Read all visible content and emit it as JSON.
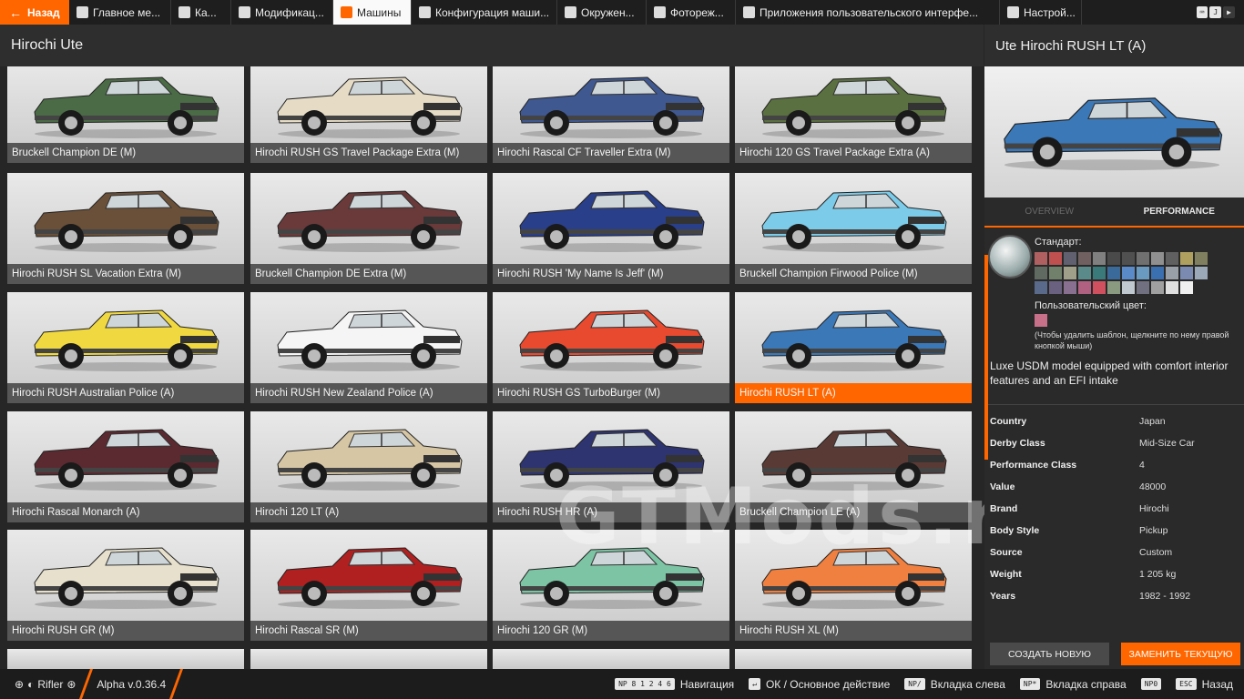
{
  "topbar": {
    "back_label": "Назад",
    "tabs": [
      {
        "label": "Главное ме...",
        "icon": "home-icon"
      },
      {
        "label": "Ка...",
        "icon": "map-icon"
      },
      {
        "label": "Модификац...",
        "icon": "puzzle-icon"
      },
      {
        "label": "Машины",
        "icon": "car-icon",
        "active": true
      },
      {
        "label": "Конфигурация маши...",
        "icon": "car-config-icon"
      },
      {
        "label": "Окружен...",
        "icon": "environment-icon"
      },
      {
        "label": "Фотореж...",
        "icon": "camera-icon"
      },
      {
        "label": "Приложения пользовательского интерфе...",
        "icon": "ui-apps-icon"
      },
      {
        "label": "Настрой...",
        "icon": "settings-icon"
      }
    ],
    "right_key": "J"
  },
  "list": {
    "title": "Hirochi Ute",
    "cards": [
      {
        "name": "Bruckell Champion DE (M)",
        "color": "#4a6b45"
      },
      {
        "name": "Hirochi RUSH GS Travel Package Extra (M)",
        "color": "#e6dcc6"
      },
      {
        "name": "Hirochi Rascal CF Traveller Extra (M)",
        "color": "#3f5890"
      },
      {
        "name": "Hirochi 120 GS Travel Package Extra (A)",
        "color": "#5a7040"
      },
      {
        "name": "Hirochi RUSH SL Vacation Extra (M)",
        "color": "#6a5038"
      },
      {
        "name": "Bruckell Champion DE Extra (M)",
        "color": "#6a3a3a"
      },
      {
        "name": "Hirochi RUSH 'My Name Is Jeff' (M)",
        "color": "#2a3f8a"
      },
      {
        "name": "Bruckell Champion Firwood Police (M)",
        "color": "#7ccbe8"
      },
      {
        "name": "Hirochi RUSH Australian Police (A)",
        "color": "#f0d840"
      },
      {
        "name": "Hirochi RUSH New Zealand Police (A)",
        "color": "#f5f5f5"
      },
      {
        "name": "Hirochi RUSH GS TurboBurger (M)",
        "color": "#e84a30"
      },
      {
        "name": "Hirochi RUSH LT (A)",
        "color": "#3a78b8",
        "selected": true
      },
      {
        "name": "Hirochi Rascal Monarch (A)",
        "color": "#5a2a30"
      },
      {
        "name": "Hirochi 120 LT (A)",
        "color": "#d6c6a4"
      },
      {
        "name": "Hirochi RUSH HR (A)",
        "color": "#2e3470"
      },
      {
        "name": "Bruckell Champion LE (A)",
        "color": "#5a3a35"
      },
      {
        "name": "Hirochi RUSH GR (M)",
        "color": "#e6e0cc"
      },
      {
        "name": "Hirochi Rascal SR (M)",
        "color": "#b02020"
      },
      {
        "name": "Hirochi 120 GR (M)",
        "color": "#7cc4a4"
      },
      {
        "name": "Hirochi RUSH XL (M)",
        "color": "#f08040"
      }
    ]
  },
  "panel": {
    "title": "Ute Hirochi RUSH LT (A)",
    "preview_color": "#3a78b8",
    "tabs": {
      "overview": "OVERVIEW",
      "performance": "PERFORMANCE"
    },
    "paint_standard_label": "Стандарт:",
    "paint_custom_label": "Пользовательский цвет:",
    "paint_hint": "(Чтобы удалить шаблон, щелкните по нему правой кнопкой мыши)",
    "swatches": [
      "#b06060",
      "#c05050",
      "#606070",
      "#706060",
      "#808080",
      "#4a4a4a",
      "#505050",
      "#707070",
      "#909090",
      "#606060",
      "#b0a060",
      "#808060",
      "#606a60",
      "#70806a",
      "#a0a08a",
      "#5a8a8a",
      "#3a7a7a",
      "#3a6a9a",
      "#5a8ac8",
      "#6a9ac0",
      "#3a70b0",
      "#9aa0a8",
      "#7a8ab0",
      "#9aa8b8",
      "#5a6a8a",
      "#6a6080",
      "#8a7090",
      "#b06080",
      "#d05060",
      "#8a9a80",
      "#c0c8d0",
      "#707080",
      "#a0a0a0",
      "#e0e0e0",
      "#f0f0f0"
    ],
    "custom_swatch": "#c8708a",
    "description": "Luxe USDM model equipped with comfort interior features and an EFI intake",
    "specs": [
      {
        "k": "Country",
        "v": "Japan"
      },
      {
        "k": "Derby Class",
        "v": "Mid-Size Car"
      },
      {
        "k": "Performance Class",
        "v": "4"
      },
      {
        "k": "Value",
        "v": "48000"
      },
      {
        "k": "Brand",
        "v": "Hirochi"
      },
      {
        "k": "Body Style",
        "v": "Pickup"
      },
      {
        "k": "Source",
        "v": "Custom"
      },
      {
        "k": "Weight",
        "v": "1 205 kg"
      },
      {
        "k": "Years",
        "v": "1982 - 1992"
      }
    ],
    "btn_new": "СОЗДАТЬ НОВУЮ",
    "btn_replace": "ЗАМЕНИТЬ ТЕКУЩУЮ"
  },
  "bottombar": {
    "user": "Rifler",
    "version": "Alpha v.0.36.4",
    "hints": [
      {
        "key": "NP 8 1 2 4 6",
        "label": "Навигация"
      },
      {
        "key": "↵",
        "label": "ОК / Основное действие"
      },
      {
        "key": "NP/",
        "label": "Вкладка слева"
      },
      {
        "key": "NP*",
        "label": "Вкладка справа"
      },
      {
        "key": "NP0",
        "label": ""
      },
      {
        "key": "ESC",
        "label": "Назад"
      }
    ]
  },
  "watermark": "GTMods.ru"
}
